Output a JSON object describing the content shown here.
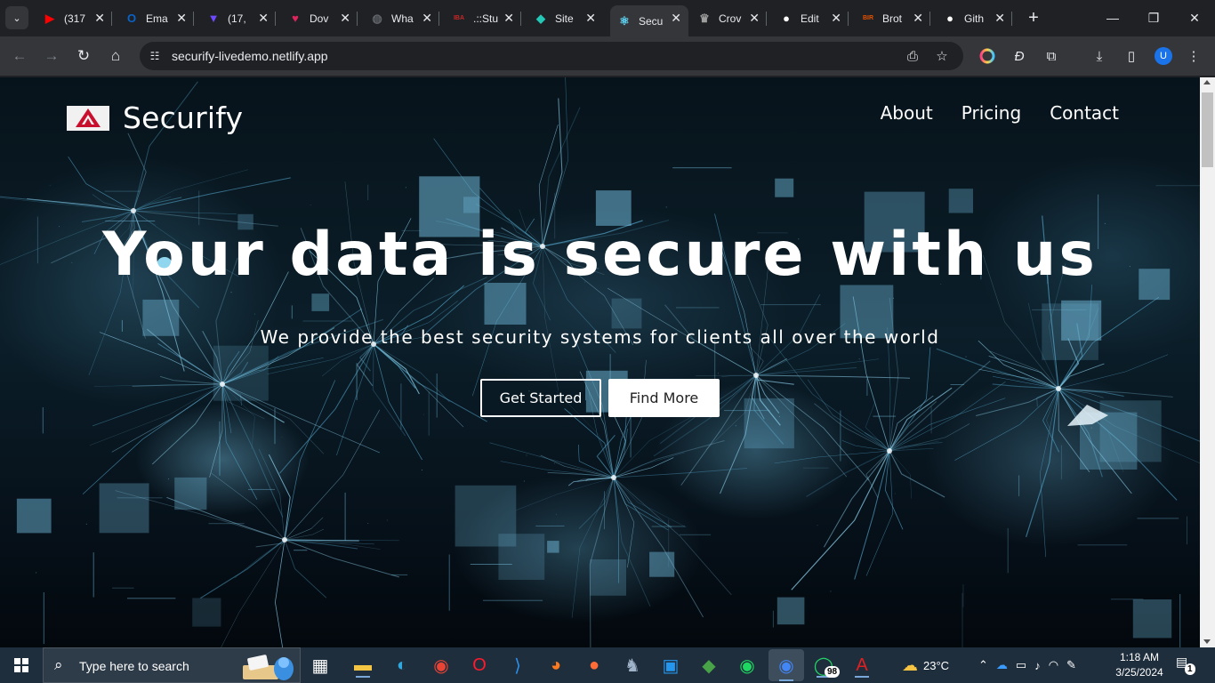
{
  "browser": {
    "tabs": [
      {
        "label": "(317",
        "favicon": "youtube-icon",
        "color": "#ff0000",
        "glyph": "▶"
      },
      {
        "label": "Ema",
        "favicon": "outlook-icon",
        "color": "#0a64c8",
        "glyph": "O"
      },
      {
        "label": "(17,",
        "favicon": "proton-icon",
        "color": "#6d4aff",
        "glyph": "▼"
      },
      {
        "label": "Dov",
        "favicon": "heart-icon",
        "color": "#e0245e",
        "glyph": "♥"
      },
      {
        "label": "Wha",
        "favicon": "globe-icon",
        "color": "#5f6368",
        "glyph": "◍"
      },
      {
        "label": ".::Stu",
        "favicon": "iba-icon",
        "color": "#c62828",
        "glyph": "IBA"
      },
      {
        "label": "Site",
        "favicon": "netlify-icon",
        "color": "#25c7b7",
        "glyph": "◆"
      },
      {
        "label": "Secu",
        "favicon": "react-icon",
        "color": "#61dafb",
        "glyph": "⚛"
      },
      {
        "label": "Crov",
        "favicon": "crown-icon",
        "color": "#9e9e9e",
        "glyph": "♛"
      },
      {
        "label": "Edit",
        "favicon": "github-icon",
        "color": "#ffffff",
        "glyph": "●"
      },
      {
        "label": "Brot",
        "favicon": "bir-icon",
        "color": "#e65100",
        "glyph": "BIR"
      },
      {
        "label": "Gith",
        "favicon": "github-icon",
        "color": "#ffffff",
        "glyph": "●"
      }
    ],
    "active_tab_index": 7,
    "url": "securify-livedemo.netlify.app"
  },
  "page": {
    "brand": "Securify",
    "nav": [
      "About",
      "Pricing",
      "Contact"
    ],
    "hero_title": "Your data is secure with us",
    "hero_subtitle": "We provide the best security systems for clients all over the world",
    "cta_primary": "Get Started",
    "cta_secondary": "Find More"
  },
  "taskbar": {
    "search_placeholder": "Type here to search",
    "apps": [
      {
        "name": "task-view-icon",
        "glyph": "▦",
        "color": "#ffffff"
      },
      {
        "name": "file-explorer-icon",
        "glyph": "▬",
        "color": "#f4c542"
      },
      {
        "name": "edge-icon",
        "glyph": "◐",
        "color": "#2fa8e0"
      },
      {
        "name": "chrome-icon",
        "glyph": "◉",
        "color": "#e84335"
      },
      {
        "name": "opera-icon",
        "glyph": "O",
        "color": "#ff1b2d"
      },
      {
        "name": "vscode-icon",
        "glyph": "⟩",
        "color": "#2c8fe8"
      },
      {
        "name": "firefox-icon",
        "glyph": "◕",
        "color": "#ff7a1f"
      },
      {
        "name": "postman-icon",
        "glyph": "●",
        "color": "#ff6c37"
      },
      {
        "name": "pgadmin-icon",
        "glyph": "♞",
        "color": "#9fb4c8"
      },
      {
        "name": "docker-icon",
        "glyph": "▣",
        "color": "#2496ed"
      },
      {
        "name": "mongodb-icon",
        "glyph": "◆",
        "color": "#47a248"
      },
      {
        "name": "spotify-icon",
        "glyph": "◉",
        "color": "#1ed760"
      },
      {
        "name": "chrome-profile-icon",
        "glyph": "◉",
        "color": "#4285f4"
      },
      {
        "name": "whatsapp-icon",
        "glyph": "◯",
        "color": "#25d366"
      },
      {
        "name": "acrobat-icon",
        "glyph": "A",
        "color": "#e02020"
      }
    ],
    "whatsapp_badge": "98",
    "temperature": "23°C",
    "time": "1:18 AM",
    "date": "3/25/2024",
    "notification_count": "1"
  }
}
